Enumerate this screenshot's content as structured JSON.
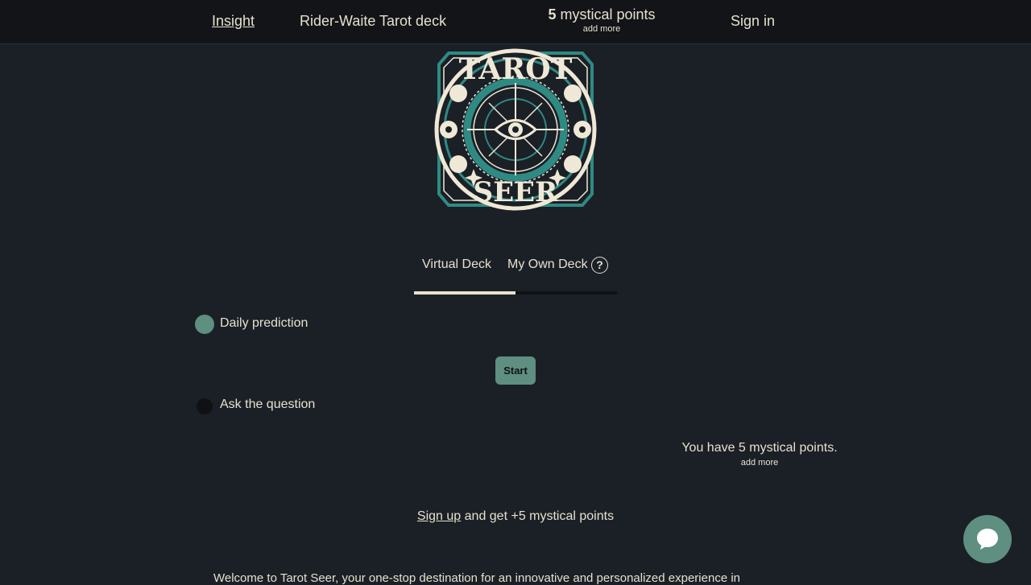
{
  "header": {
    "insight_label": "Insight",
    "deck_label": "Rider-Waite Tarot deck",
    "points_count": "5",
    "points_label": "mystical points",
    "add_more_label": "add more",
    "signin_label": "Sign in"
  },
  "logo": {
    "top_text": "TAROT",
    "bottom_text": "SEER",
    "colors": {
      "teal": "#2f8a84",
      "cream": "#efe8d6"
    }
  },
  "tabs": [
    {
      "label": "Virtual Deck",
      "active": true
    },
    {
      "label": "My Own Deck",
      "active": false
    }
  ],
  "help_icon": "?",
  "options": [
    {
      "label": "Daily prediction",
      "selected": true
    },
    {
      "label": "Ask the question",
      "selected": false
    }
  ],
  "start_label": "Start",
  "points_status": {
    "text": "You have 5 mystical points.",
    "add_more_label": "add more"
  },
  "signup": {
    "link_label": "Sign up",
    "rest_text": "and get +5 mystical points"
  },
  "welcome_text": "Welcome to Tarot Seer, your one-stop destination for an innovative and personalized experience in",
  "colors": {
    "background": "#1b2026",
    "topbar": "#121417",
    "accent": "#5e8f80",
    "text": "#e7e0cf"
  },
  "chat_icon": "chat-bubble-icon"
}
